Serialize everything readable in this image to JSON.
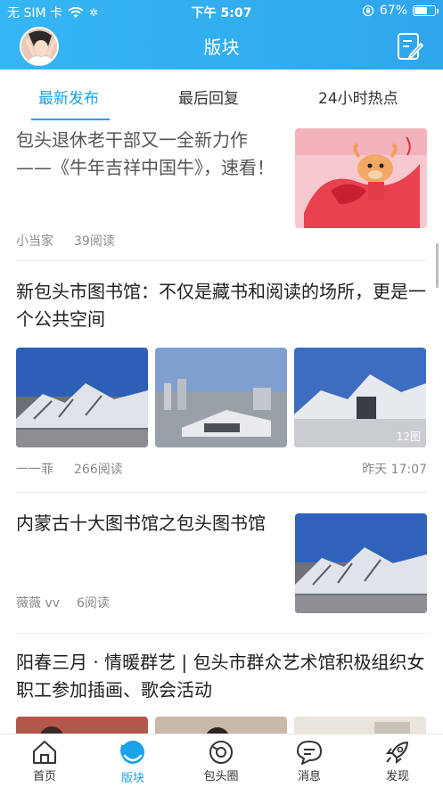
{
  "status_bar": {
    "carrier": "无 SIM 卡",
    "time": "下午 5:07",
    "battery": "67%",
    "battery_level": 0.67
  },
  "nav": {
    "title": "版块"
  },
  "tabs": [
    {
      "label": "最新发布",
      "active": true
    },
    {
      "label": "最后回复",
      "active": false
    },
    {
      "label": "24小时热点",
      "active": false
    }
  ],
  "feed": [
    {
      "title": "包头退休老干部又一全新力作——《牛年吉祥中国牛》，速看！",
      "author": "小当家",
      "reads": "39阅读"
    },
    {
      "title": "新包头市图书馆：不仅是藏书和阅读的场所，更是一个公共空间",
      "author": "一一菲",
      "reads": "266阅读",
      "time": "昨天 17:07",
      "image_count": "12图"
    },
    {
      "title": "内蒙古十大图书馆之包头图书馆",
      "author": "薇薇 vv",
      "reads": "6阅读"
    },
    {
      "title": "阳春三月 · 情暖群艺 | 包头市群众艺术馆积极组织女职工参加插画、歌会活动"
    }
  ],
  "tabbar": [
    {
      "label": "首页",
      "icon": "home-icon",
      "active": false
    },
    {
      "label": "版块",
      "icon": "board-icon",
      "active": true
    },
    {
      "label": "包头圈",
      "icon": "circle-icon",
      "active": false
    },
    {
      "label": "消息",
      "icon": "message-icon",
      "active": false
    },
    {
      "label": "发现",
      "icon": "rocket-icon",
      "active": false
    }
  ],
  "colors": {
    "accent": "#1aa3e8",
    "nav_bg": "#35b6f2"
  }
}
